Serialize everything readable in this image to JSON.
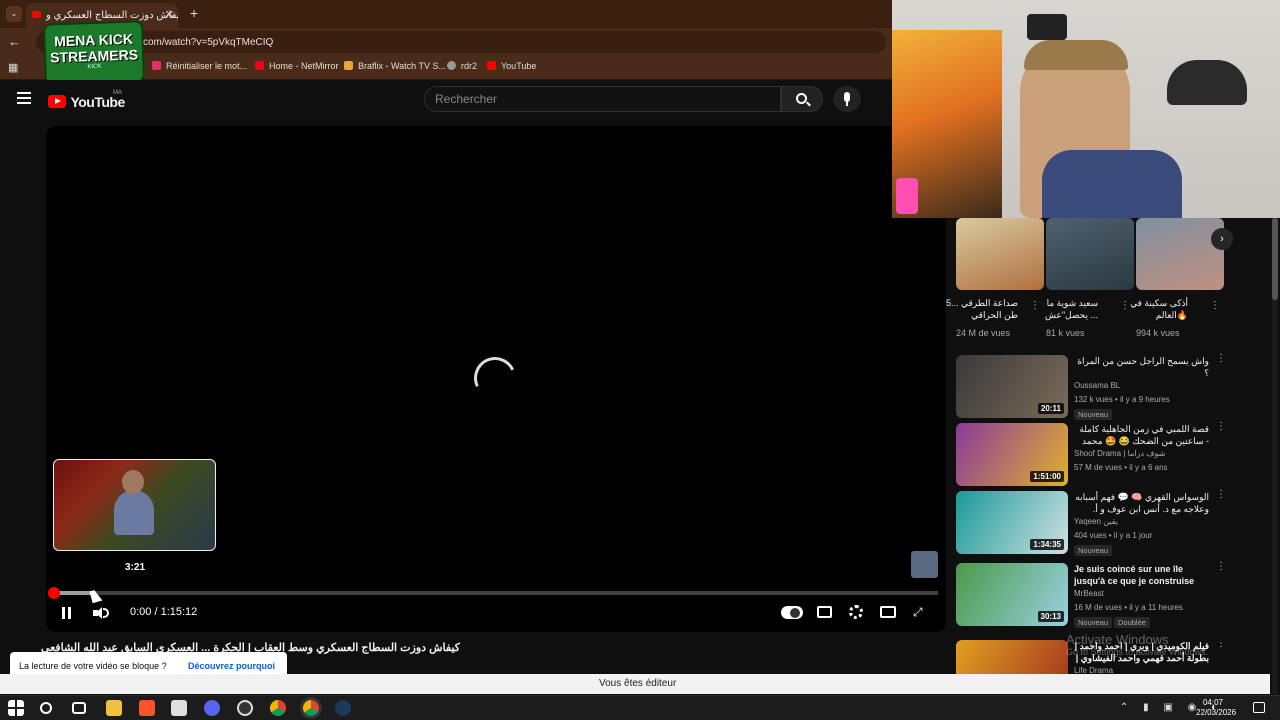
{
  "browser": {
    "tab_title": "كيفاش دوزت السطاج العسكري و",
    "new_tab_symbol": "+",
    "url": "com/watch?v=5pVkqTMeCIQ",
    "bookmarks": [
      {
        "label": "Réinitialiser le mot...",
        "color": "#e1306c"
      },
      {
        "label": "Home - NetMirror",
        "color": "#e50914"
      },
      {
        "label": "Braflix - Watch TV S...",
        "color": "#e8a33c"
      },
      {
        "label": "rdr2",
        "color": "#999999"
      },
      {
        "label": "YouTube",
        "color": "#ff0000"
      }
    ]
  },
  "overlay_logo": {
    "line1": "MENA KICK",
    "line2": "STREAMERS",
    "small": "KICK"
  },
  "youtube": {
    "logo_text": "YouTube",
    "region": "MA",
    "search_placeholder": "Rechercher"
  },
  "player": {
    "preview_time": "3:21",
    "current_time": "0:00",
    "separator": " / ",
    "duration": "1:15:12",
    "progress_fraction": 0.001,
    "hover_fraction": 0.045
  },
  "video": {
    "title": "كيفاش دوزت السطاج العسكري وسط العقاب | الحكرة ... العسكري السابق عبد الله الشافعي يحكي"
  },
  "blocked_banner": {
    "text": "La lecture de votre vidéo se bloque ?",
    "link": "Découvrez pourquoi"
  },
  "editor_bar": {
    "text": "Vous êtes éditeur"
  },
  "shorts": [
    {
      "title": "صداعة الطرقي ...5 طن الحراقي",
      "views": "24 M de vues"
    },
    {
      "title": "سعيد شوية ما يحصل\"عش ...",
      "views": "81 k vues"
    },
    {
      "title": "أذكى سكينة في العالم🔥",
      "views": "994 k vues"
    }
  ],
  "recommendations": [
    {
      "title": "واش يسمح الراجل حسن من المراة ؟",
      "channel": "Oussama BL",
      "meta": "132 k vues • il y a 9 heures",
      "badge": "Nouveau",
      "duration": "20:11"
    },
    {
      "title": "قصة اللمبي في زمن الجاهلية كاملة - ساعتين من الضحك 😂 🤩 محمد سعد - فيلم اطلط",
      "channel": "Shoof Drama | شوف دراما",
      "meta": "57 M de vues • il y a 6 ans",
      "badge": "",
      "duration": "1:51:00"
    },
    {
      "title": "الوسواس القهري 🧠 💬 فهم أسبابه وعلاجه مع د. أنس ابن عوف و أ. ياسر ...",
      "channel": "Yaqeen يقين",
      "meta": "404 vues • il y a 1 jour",
      "badge": "Nouveau",
      "duration": "1:34:35"
    },
    {
      "title": "Je suis coincé sur une île jusqu'à ce que je construise un...",
      "channel": "MrBeast",
      "meta": "16 M de vues • il y a 11 heures",
      "badge": "Nouveau",
      "badge2": "Doublée",
      "duration": "30:13"
    },
    {
      "title": "فيلم الكوميدي | وبري | احمد واحمد | بطولة أحمد فهمي واحمد الفيشاوي | Full Movie HD",
      "channel": "Life Drama",
      "meta": "",
      "badge": "",
      "duration": ""
    }
  ],
  "watermark": {
    "line1": "Activate Windows",
    "line2": "Go to Settings to activate Windows."
  },
  "taskbar": {
    "time": "04:07",
    "date": "22/03/2026"
  },
  "colors": {
    "accent_red": "#ff0000",
    "bg": "#0f0f0f"
  }
}
